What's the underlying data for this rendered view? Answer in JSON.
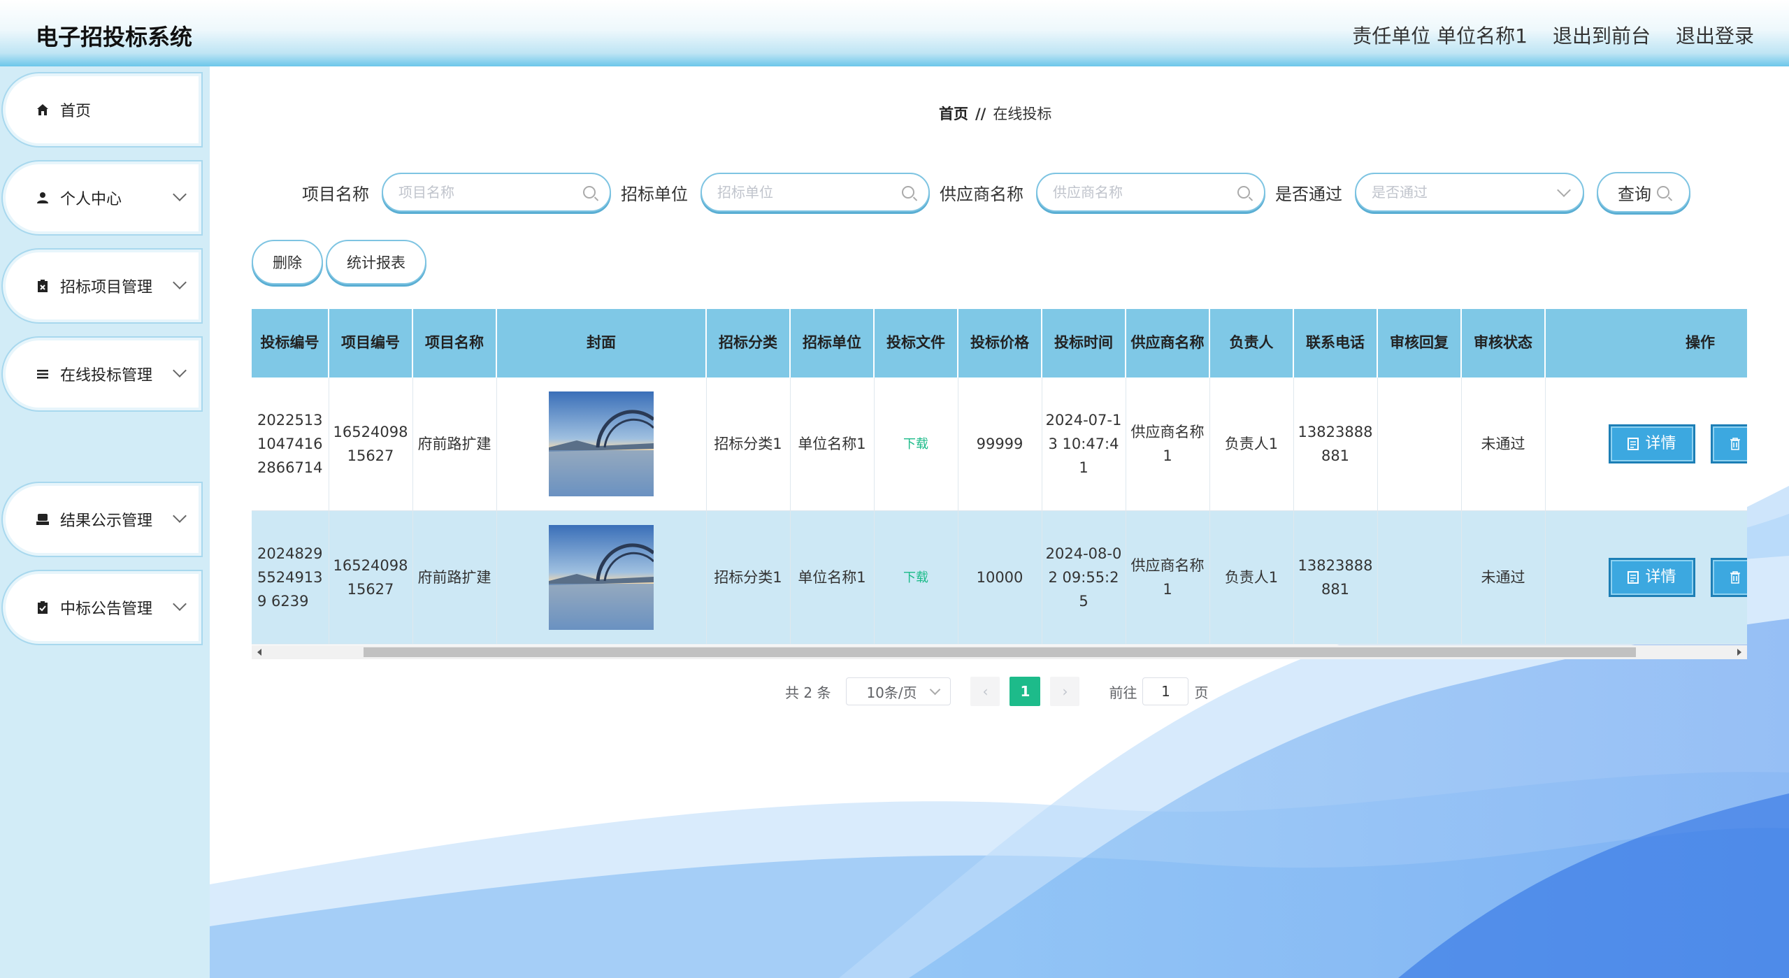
{
  "header": {
    "title": "电子招投标系统",
    "user": "责任单位 单位名称1",
    "to_front": "退出到前台",
    "logout": "退出登录"
  },
  "sidebar": {
    "items": [
      {
        "label": "首页",
        "icon": "home-icon"
      },
      {
        "label": "个人中心",
        "icon": "user-icon"
      },
      {
        "label": "招标项目管理",
        "icon": "clipboard-icon"
      },
      {
        "label": "在线投标管理",
        "icon": "list-icon"
      },
      {
        "label": "结果公示管理",
        "icon": "inbox-icon"
      },
      {
        "label": "中标公告管理",
        "icon": "clipboard-check-icon"
      }
    ],
    "sub_item": "在线投标"
  },
  "breadcrumb": {
    "home": "首页",
    "sep": "//",
    "current": "在线投标"
  },
  "search": {
    "fields": [
      {
        "label": "项目名称",
        "placeholder": "项目名称"
      },
      {
        "label": "招标单位",
        "placeholder": "招标单位"
      },
      {
        "label": "供应商名称",
        "placeholder": "供应商名称"
      },
      {
        "label": "是否通过",
        "placeholder": "是否通过"
      }
    ],
    "query_label": "查询"
  },
  "actions": {
    "delete_label": "删除",
    "report_label": "统计报表"
  },
  "table": {
    "headers": [
      "投标编号",
      "项目编号",
      "项目名称",
      "封面",
      "招标分类",
      "招标单位",
      "投标文件",
      "投标价格",
      "投标时间",
      "供应商名称",
      "负责人",
      "联系电话",
      "审核回复",
      "审核状态",
      "操作"
    ],
    "rows": [
      {
        "bid_no": "20225131047416286671 4",
        "bid_no_display": "202251310474162866714",
        "project_no": "1652409815627",
        "project_name": "府前路扩建",
        "category": "招标分类1",
        "unit": "单位名称1",
        "file": "下载",
        "price": "99999",
        "time": "2024-07-13 10:47:41",
        "supplier": "供应商名称1",
        "manager": "负责人1",
        "phone": "13823888881",
        "reply": "",
        "status": "未通过",
        "detail_label": "详情"
      },
      {
        "bid_no_display": "202482955249139 6239",
        "project_no": "1652409815627",
        "project_name": "府前路扩建",
        "category": "招标分类1",
        "unit": "单位名称1",
        "file": "下载",
        "price": "10000",
        "time": "2024-08-02 09:55:25",
        "supplier": "供应商名称1",
        "manager": "负责人1",
        "phone": "13823888881",
        "reply": "",
        "status": "未通过",
        "detail_label": "详情"
      }
    ]
  },
  "pagination": {
    "total": "共 2 条",
    "page_size": "10条/页",
    "current_page": "1",
    "goto_label": "前往",
    "goto_value": "1",
    "page_unit": "页"
  },
  "colors": {
    "header_accent": "#6cc6ea",
    "sidebar_bg": "#d2ecf7",
    "table_header": "#7fc8e6",
    "row_alt": "#cde8f5",
    "button_blue": "#3ca8e0",
    "page_active": "#1dbb8a"
  }
}
